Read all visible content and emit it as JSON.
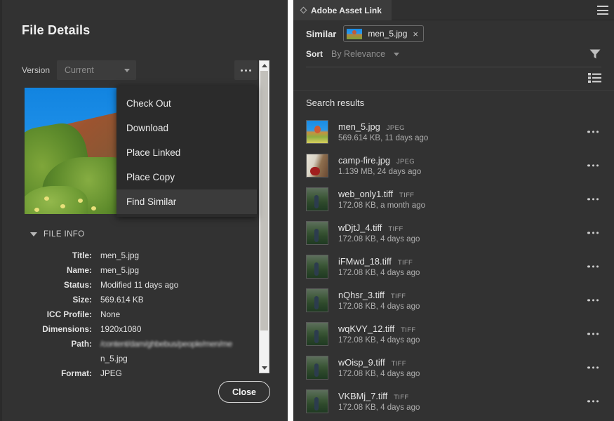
{
  "left_dialog": {
    "title": "File Details",
    "version": {
      "label": "Version",
      "value": "Current",
      "chevron_icon": "chevron-down-icon"
    },
    "more_button": "...",
    "preview_alt": "men_5.jpg preview",
    "file_info": {
      "section_label": "FILE INFO",
      "rows": [
        {
          "key": "Title:",
          "value": "men_5.jpg"
        },
        {
          "key": "Name:",
          "value": "men_5.jpg"
        },
        {
          "key": "Status:",
          "value": "Modified 11 days ago"
        },
        {
          "key": "Size:",
          "value": "569.614 KB"
        },
        {
          "key": "ICC Profile:",
          "value": "None"
        },
        {
          "key": "Dimensions:",
          "value": "1920x1080"
        },
        {
          "key": "Path:",
          "value": "/content/dam/ghbebus/people/men/me"
        },
        {
          "key": "",
          "value": "n_5.jpg"
        },
        {
          "key": "Format:",
          "value": "JPEG"
        }
      ]
    },
    "close_label": "Close"
  },
  "context_menu": {
    "items": [
      {
        "label": "Check Out",
        "active": false
      },
      {
        "label": "Download",
        "active": false
      },
      {
        "label": "Place Linked",
        "active": false
      },
      {
        "label": "Place Copy",
        "active": false
      },
      {
        "label": "Find Similar",
        "active": true
      }
    ]
  },
  "right_panel": {
    "tab_label": "Adobe Asset Link",
    "panel_menu_icon": "hamburger-icon",
    "similar": {
      "label": "Similar",
      "chip_name": "men_5.jpg",
      "chip_close": "×"
    },
    "sort": {
      "label": "Sort",
      "value": "By Relevance",
      "chevron_icon": "chevron-down-icon"
    },
    "filter_icon": "funnel-icon",
    "view_icon": "list-view-icon",
    "results_title": "Search results",
    "results": [
      {
        "name": "men_5.jpg",
        "format": "JPEG",
        "meta": "569.614 KB, 11 days ago",
        "thumb": "sunset"
      },
      {
        "name": "camp-fire.jpg",
        "format": "JPEG",
        "meta": "1.139 MB, 24 days ago",
        "thumb": "fire"
      },
      {
        "name": "web_only1.tiff",
        "format": "TIFF",
        "meta": "172.08 KB, a month ago",
        "thumb": "field"
      },
      {
        "name": "wDjtJ_4.tiff",
        "format": "TIFF",
        "meta": "172.08 KB, 4 days ago",
        "thumb": "field"
      },
      {
        "name": "iFMwd_18.tiff",
        "format": "TIFF",
        "meta": "172.08 KB, 4 days ago",
        "thumb": "field"
      },
      {
        "name": "nQhsr_3.tiff",
        "format": "TIFF",
        "meta": "172.08 KB, 4 days ago",
        "thumb": "field"
      },
      {
        "name": "wqKVY_12.tiff",
        "format": "TIFF",
        "meta": "172.08 KB, 4 days ago",
        "thumb": "field"
      },
      {
        "name": "wOisp_9.tiff",
        "format": "TIFF",
        "meta": "172.08 KB, 4 days ago",
        "thumb": "field"
      },
      {
        "name": "VKBMj_7.tiff",
        "format": "TIFF",
        "meta": "172.08 KB, 4 days ago",
        "thumb": "field"
      }
    ],
    "row_menu_icon": "more-options-icon"
  },
  "colors": {
    "panel_bg": "#323232",
    "menu_bg": "#2b2b2b",
    "menu_active": "#3b3b3b",
    "text": "#e6e6e6",
    "muted_text": "#8f8f8f",
    "divider": "#fefefe",
    "scrollbar_track": "#f2f2f2",
    "scrollbar_thumb": "#c2c0bb"
  }
}
